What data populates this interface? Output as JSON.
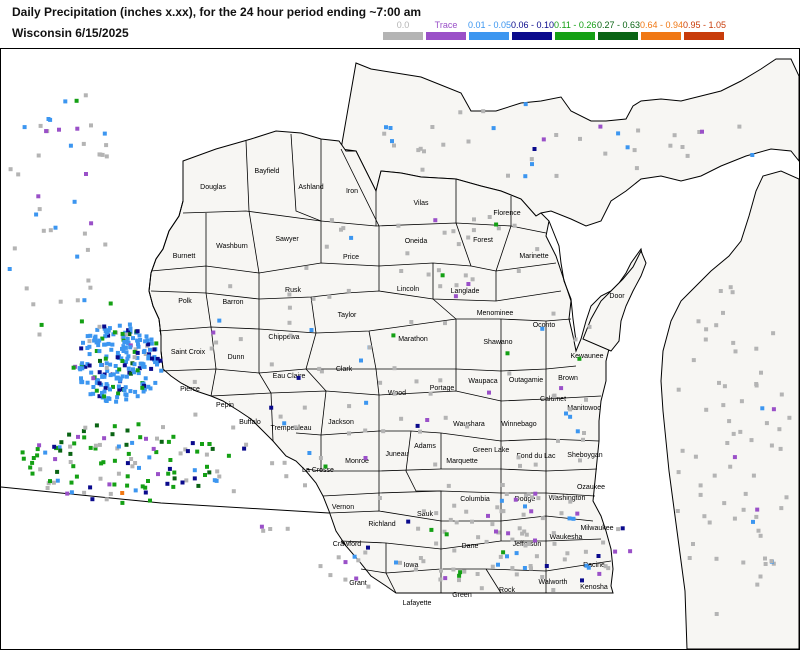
{
  "header": {
    "title_line1": "Daily Precipitation (inches  x.xx),  for the 24 hour period ending ~7:00 am",
    "title_line2": "Wisconsin 6/15/2025"
  },
  "legend": [
    {
      "label": "0.0",
      "color": "#b4b4b4"
    },
    {
      "label": "Trace",
      "color": "#9a50c8"
    },
    {
      "label": "0.01 - 0.05",
      "color": "#3c96f0"
    },
    {
      "label": "0.06 - 0.10",
      "color": "#0a0a8c"
    },
    {
      "label": "0.11 - 0.26",
      "color": "#14a014"
    },
    {
      "label": "0.27 - 0.63",
      "color": "#0a6414"
    },
    {
      "label": "0.64 - 0.94",
      "color": "#f07814"
    },
    {
      "label": "0.95 - 1.05",
      "color": "#c83c0a"
    }
  ],
  "counties": [
    "Douglas",
    "Bayfield",
    "Ashland",
    "Iron",
    "Vilas",
    "Florence",
    "Burnett",
    "Washburn",
    "Sawyer",
    "Price",
    "Oneida",
    "Forest",
    "Marinette",
    "Polk",
    "Barron",
    "Rusk",
    "Lincoln",
    "Langlade",
    "Menominee",
    "Oconto",
    "Door",
    "Taylor",
    "Saint Croix",
    "Dunn",
    "Chippewa",
    "Marathon",
    "Shawano",
    "Kewaunee",
    "Pierce",
    "Eau Claire",
    "Clark",
    "Wood",
    "Portage",
    "Waupaca",
    "Outagamie",
    "Brown",
    "Pepin",
    "Buffalo",
    "Trempealeau",
    "Jackson",
    "Calumet",
    "Manitowoc",
    "Waushara",
    "Winnebago",
    "Monroe",
    "Juneau",
    "Adams",
    "Marquette",
    "Green Lake",
    "Fond du Lac",
    "Sheboygan",
    "La Crosse",
    "Vernon",
    "Sauk",
    "Columbia",
    "Dodge",
    "Washington",
    "Ozaukee",
    "Richland",
    "Crawford",
    "Milwaukee",
    "Waukesha",
    "Jefferson",
    "Dane",
    "Iowa",
    "Grant",
    "Lafayette",
    "Green",
    "Rock",
    "Walworth",
    "Racine",
    "Kenosha"
  ]
}
